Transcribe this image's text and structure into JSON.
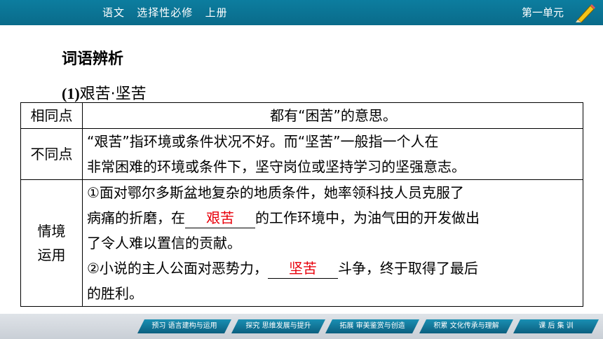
{
  "header": {
    "book": "语文   选择性必修   上册",
    "unit": "第一单元",
    "pen_icon": "pencil-icon"
  },
  "title": "词语辨析",
  "subtitle": {
    "num": "(1)",
    "text": "艰苦·坚苦"
  },
  "table": {
    "row1": {
      "label": "相同点",
      "content": "都有“困苦”的意思。"
    },
    "row2": {
      "label": "不同点",
      "line1": "“艰苦”指环境或条件状况不好。而“坚苦”一般指一个人在",
      "line2": "非常困难的环境或条件下，坚守岗位或坚持学习的坚强意志。"
    },
    "row3": {
      "label_line1": "情境",
      "label_line2": "运用",
      "line1": "①面对鄂尔多斯盆地复杂的地质条件，她率领科技人员克服了",
      "line2_pre": "病痛的折磨，在",
      "answer1": "艰苦",
      "line2_post": "的工作环境中，为油气田的开发做出",
      "line3": "了令人难以置信的贡献。",
      "line4_pre": "②小说的主人公面对恶势力，",
      "answer2": "坚苦",
      "line4_post": "斗争，终于取得了最后",
      "line5": "的胜利。"
    }
  },
  "footer": {
    "nav": [
      "预习 语言建构与运用",
      "探究 思维发展与提升",
      "拓展 审美鉴赏与创造",
      "积累 文化传承与理解",
      "课 后 集 训"
    ]
  },
  "colors": {
    "header": "#0a6b8a",
    "answer": "#e8000b",
    "nav": "#0b5f7f"
  }
}
